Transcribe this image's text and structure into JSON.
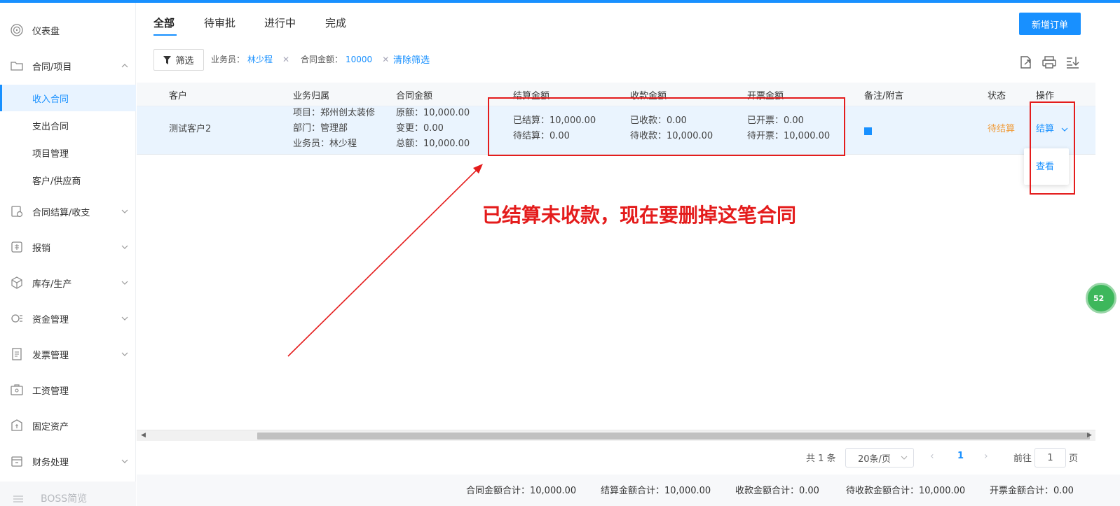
{
  "sidebar": {
    "items": [
      {
        "label": "仪表盘",
        "icon": "dashboard-icon"
      },
      {
        "label": "合同/项目",
        "icon": "folder-icon",
        "expanded": true,
        "children": [
          {
            "label": "收入合同",
            "active": true
          },
          {
            "label": "支出合同"
          },
          {
            "label": "项目管理"
          },
          {
            "label": "客户/供应商"
          }
        ]
      },
      {
        "label": "合同结算/收支",
        "icon": "settlement-icon"
      },
      {
        "label": "报销",
        "icon": "reimburse-icon"
      },
      {
        "label": "库存/生产",
        "icon": "box-icon"
      },
      {
        "label": "资金管理",
        "icon": "fund-icon"
      },
      {
        "label": "发票管理",
        "icon": "invoice-icon"
      },
      {
        "label": "工资管理",
        "icon": "salary-icon"
      },
      {
        "label": "固定资产",
        "icon": "asset-icon"
      },
      {
        "label": "财务处理",
        "icon": "finance-icon"
      },
      {
        "label": "BOSS简览",
        "icon": "boss-icon"
      }
    ]
  },
  "tabs": [
    "全部",
    "待审批",
    "进行中",
    "完成"
  ],
  "active_tab": "全部",
  "new_order_label": "新增订单",
  "filter": {
    "button_label": "筛选",
    "chips": [
      {
        "key": "业务员：",
        "value": "林少程"
      },
      {
        "key": "合同金额：",
        "value": "10000"
      }
    ],
    "clear_label": "清除筛选"
  },
  "toolbar_icons": [
    "export-icon",
    "print-icon",
    "download-icon"
  ],
  "table": {
    "headers": [
      "客户",
      "业务归属",
      "合同金额",
      "结算金额",
      "收款金额",
      "开票金额",
      "备注/附言",
      "状态",
      "操作"
    ],
    "row": {
      "customer": "测试客户2",
      "ownership": [
        "项目：郑州创太装修",
        "部门：管理部",
        "业务员：林少程"
      ],
      "amount": [
        "原额：10,000.00",
        "变更：0.00",
        "总额：10,000.00"
      ],
      "settlement": [
        "已结算：10,000.00",
        "待结算：0.00"
      ],
      "receipt": [
        "已收款：0.00",
        "待收款：10,000.00"
      ],
      "invoice": [
        "已开票：0.00",
        "待开票：10,000.00"
      ],
      "status": "待结算",
      "action": "结算"
    },
    "action_dropdown": [
      "查看"
    ]
  },
  "annotation": {
    "text": "已结算未收款，现在要删掉这笔合同",
    "color": "#e41c1c"
  },
  "pagination": {
    "total": "共 1 条",
    "page_size": "20条/页",
    "current_page": "1",
    "goto_label": "前往",
    "goto_value": "1",
    "page_suffix": "页"
  },
  "summary": [
    "合同金额合计：10,000.00",
    "结算金额合计：10,000.00",
    "收款金额合计：0.00",
    "待收款金额合计：10,000.00",
    "开票金额合计：0.00"
  ],
  "float_badge": "52",
  "colors": {
    "primary": "#1890ff",
    "warning": "#f09a36",
    "annotation": "#e41c1c"
  }
}
